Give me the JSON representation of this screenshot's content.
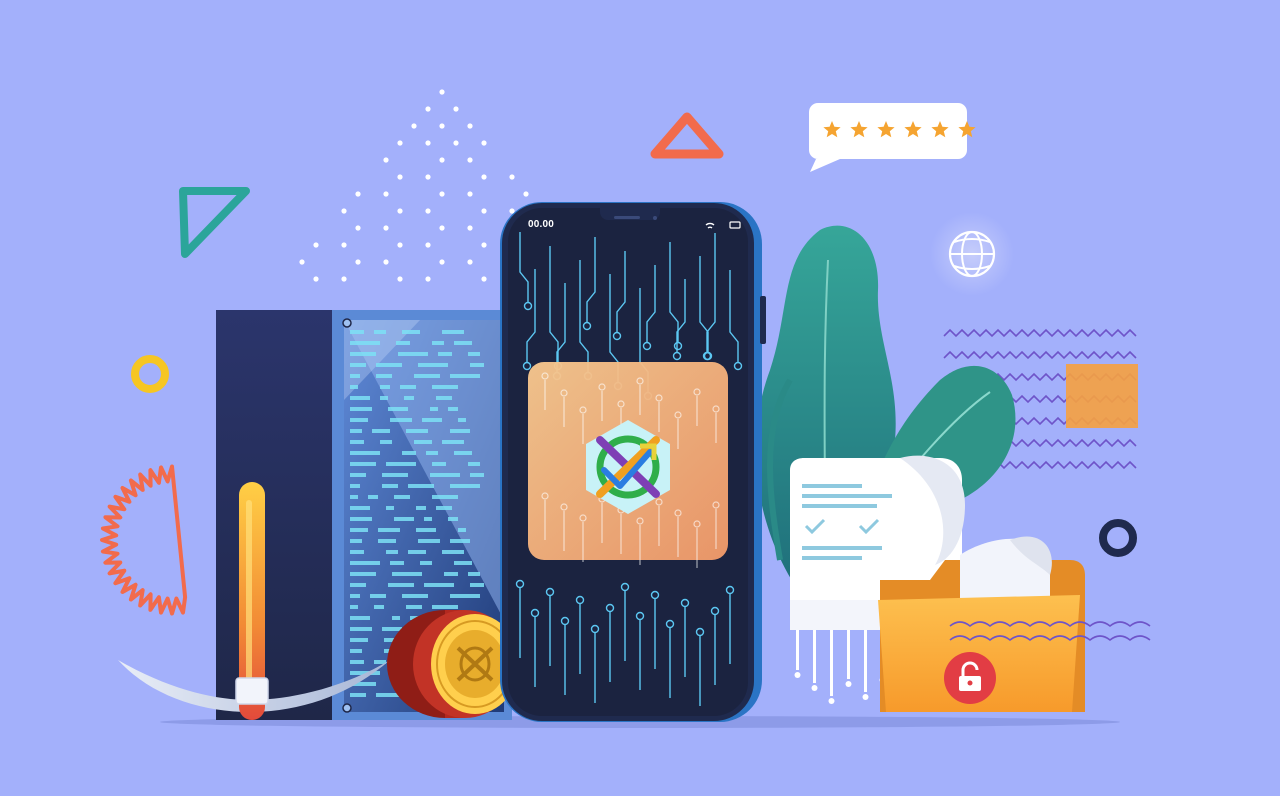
{
  "illustration": {
    "theme": "cryptocurrency mining mobile app illustration",
    "background_color": "#a3b0fb",
    "phone": {
      "status_time": "00.00",
      "screen_color": "#1b2340",
      "circuit_color": "#5cc7f2",
      "app_tile_color": "#f7b17c",
      "app_icon": "hexagon-coin-logo-icon"
    },
    "rating_bubble": {
      "stars": 6,
      "star_color": "#f5a431"
    },
    "decor": {
      "accent_orange": "#f26b4c",
      "accent_yellow": "#f6c623",
      "accent_teal": "#2ba59a",
      "accent_navy": "#1f2a4e",
      "accent_purple": "#6e54c9"
    },
    "items": [
      "server-rack",
      "pickaxe",
      "gold-coin",
      "plant",
      "document",
      "folder",
      "globe-icon",
      "lock-icon"
    ]
  }
}
